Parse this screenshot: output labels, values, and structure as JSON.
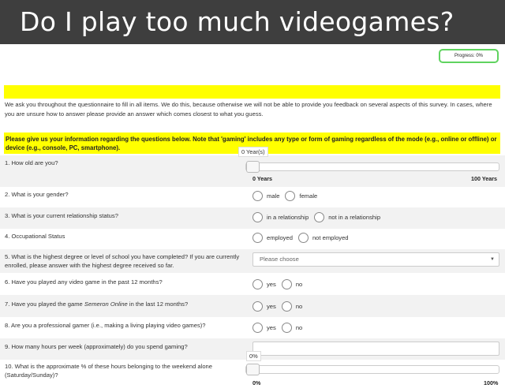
{
  "banner": {
    "title": "Do I play too much videogames?"
  },
  "progress": {
    "label": "Progress: 0%"
  },
  "intro": {
    "text": "We ask you throughout the questionnaire to fill in all items. We do this, because otherwise we will not be able to provide you feedback on several aspects of this survey. In cases, where you are unsure how to answer please provide an answer which comes closest to what you guess."
  },
  "notice": {
    "text": "Please give us your information regarding the questions below. Note that 'gaming' includes any type or form of gaming regardless of the mode (e.g., online or offline) or device (e.g., console, PC, smartphone)."
  },
  "questions": {
    "age": {
      "label": "1. How old are you?",
      "tooltip": "0 Year(s)",
      "min_label": "0 Years",
      "max_label": "100 Years",
      "value": 0
    },
    "gender": {
      "label": "2. What is your gender?",
      "options": [
        "male",
        "female"
      ]
    },
    "relationship": {
      "label": "3. What is your current relationship status?",
      "options": [
        "in a relationship",
        "not in a relationship"
      ]
    },
    "occupation": {
      "label": "4. Occupational Status",
      "options": [
        "employed",
        "not employed"
      ]
    },
    "education": {
      "label": "5. What is the highest degree or level of school you have completed? If you are currently enrolled, please answer with the highest degree received so far.",
      "placeholder": "Please choose"
    },
    "played12": {
      "label": "6. Have you played any video game in the past 12 months?",
      "options": [
        "yes",
        "no"
      ]
    },
    "semeron": {
      "label_before": "7. Have you played the game ",
      "label_game": "Semeron Online",
      "label_after": " in the last 12 months?",
      "options": [
        "yes",
        "no"
      ]
    },
    "pro": {
      "label": "8. Are you a professional gamer (i.e., making a living playing video games)?",
      "options": [
        "yes",
        "no"
      ]
    },
    "hours": {
      "label": "9. How many hours per week (approximately) do you spend gaming?"
    },
    "weekend": {
      "label": "10. What is the approximate % of these hours belonging to the weekend alone (Saturday/Sunday)?",
      "tooltip": "0%",
      "min_label": "0%",
      "max_label": "100%",
      "value": 0
    }
  }
}
